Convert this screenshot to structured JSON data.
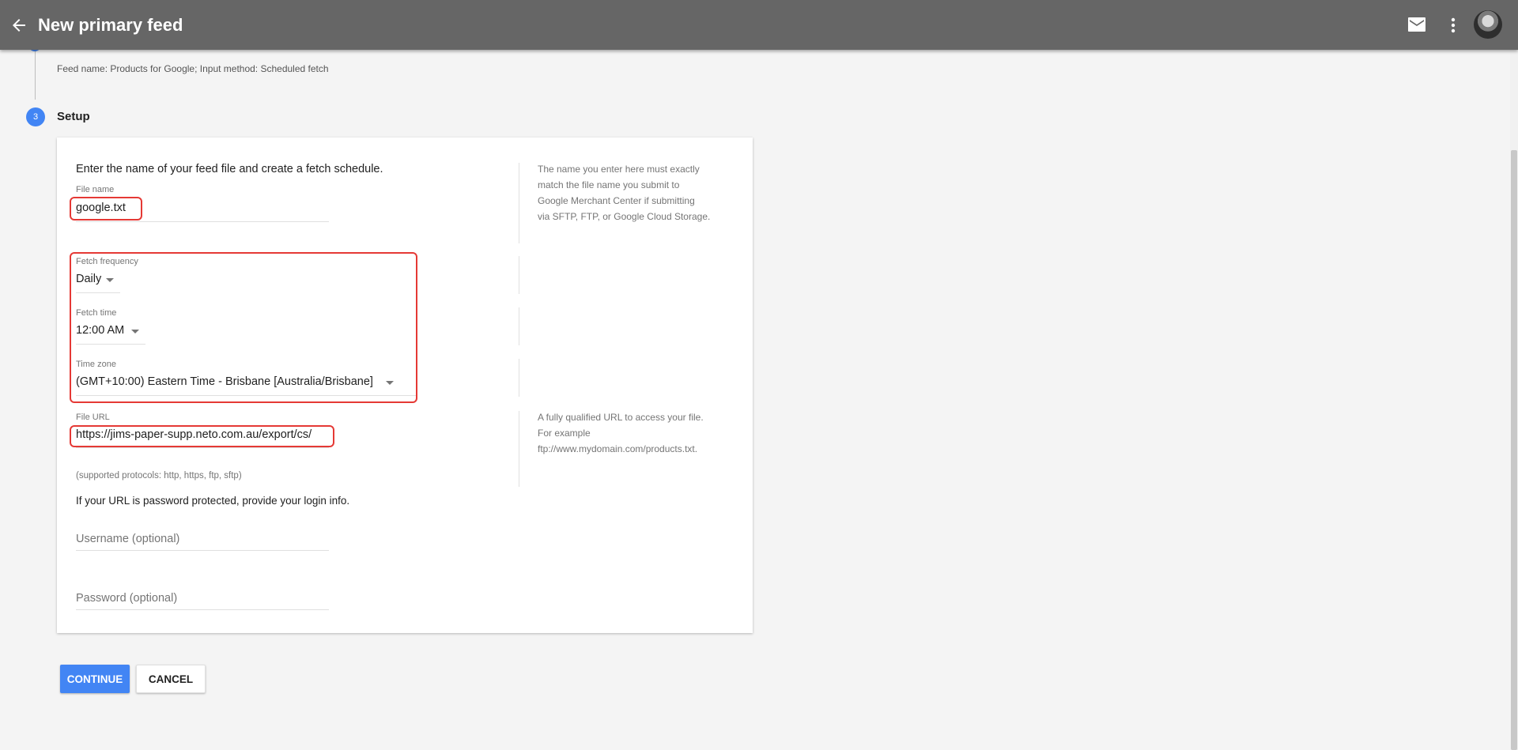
{
  "header": {
    "back_icon": "arrow-left-icon",
    "title": "New primary feed",
    "mail_icon": "mail-icon",
    "more_icon": "more-vert-icon",
    "avatar": "user-avatar"
  },
  "stepper": {
    "previous_summary": "Feed name: Products for Google; Input method: Scheduled fetch",
    "step_number": "3",
    "step_title": "Setup"
  },
  "form": {
    "intro": "Enter the name of your feed file and create a fetch schedule.",
    "file_name": {
      "label": "File name",
      "value": "google.txt"
    },
    "file_name_help": "The name you enter here must exactly\nmatch the file name you submit to\nGoogle Merchant Center if submitting\nvia SFTP, FTP, or Google Cloud Storage.",
    "fetch_frequency": {
      "label": "Fetch frequency",
      "value": "Daily"
    },
    "fetch_time": {
      "label": "Fetch time",
      "value": "12:00 AM"
    },
    "time_zone": {
      "label": "Time zone",
      "value": "(GMT+10:00) Eastern Time - Brisbane [Australia/Brisbane]"
    },
    "file_url": {
      "label": "File URL",
      "value": "https://jims-paper-supp.neto.com.au/export/cs/"
    },
    "file_url_help": "A fully qualified URL to access your file.\nFor example\nftp://www.mydomain.com/products.txt.",
    "supported_protocols": "(supported protocols: http, https, ftp, sftp)",
    "password_note": "If your URL is password protected, provide your login info.",
    "username_placeholder": "Username (optional)",
    "password_placeholder": "Password (optional)"
  },
  "actions": {
    "continue_label": "CONTINUE",
    "cancel_label": "CANCEL"
  },
  "colors": {
    "topbar": "#666666",
    "accent": "#4285f4",
    "annotation": "#e53935"
  }
}
